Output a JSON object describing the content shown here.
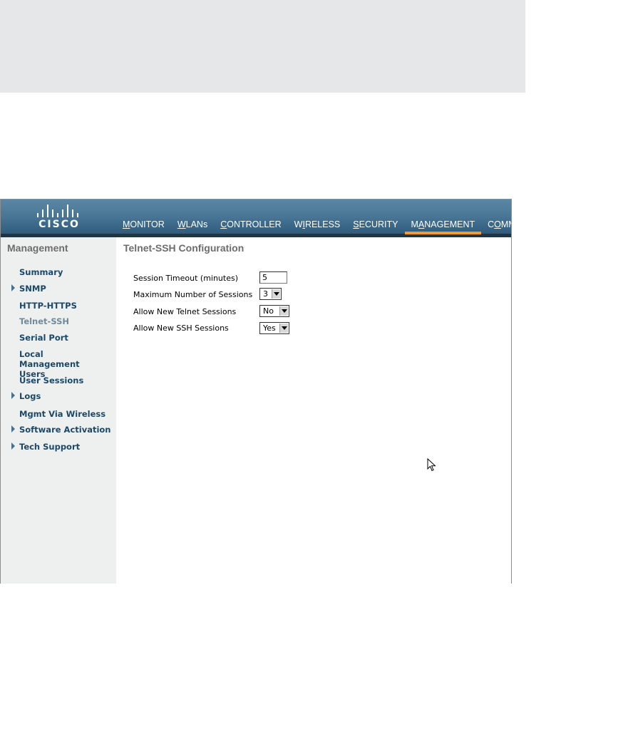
{
  "brand": {
    "logo_text": "CISCO"
  },
  "nav": {
    "items": [
      {
        "key": "M",
        "rest": "ONITOR",
        "pre": ""
      },
      {
        "key": "W",
        "rest": "LANs",
        "pre": ""
      },
      {
        "key": "C",
        "rest": "ONTROLLER",
        "pre": ""
      },
      {
        "key": "I",
        "rest": "RELESS",
        "pre": "W"
      },
      {
        "key": "S",
        "rest": "ECURITY",
        "pre": ""
      },
      {
        "key": "A",
        "rest": "NAGEMENT",
        "pre": "M"
      },
      {
        "key": "O",
        "rest": "MMANDS",
        "pre": "C"
      }
    ],
    "active": "MANAGEMENT"
  },
  "sidebar": {
    "title": "Management",
    "items": [
      {
        "label": "Summary"
      },
      {
        "label": "SNMP"
      },
      {
        "label": "HTTP-HTTPS"
      },
      {
        "label": "Telnet-SSH"
      },
      {
        "label": "Serial Port"
      },
      {
        "label": "Local Management Users"
      },
      {
        "label": "User Sessions"
      },
      {
        "label": "Logs"
      },
      {
        "label": "Mgmt Via Wireless"
      },
      {
        "label": "Software Activation"
      },
      {
        "label": "Tech Support"
      }
    ]
  },
  "main": {
    "title": "Telnet-SSH Configuration",
    "fields": {
      "session_timeout": {
        "label": "Session Timeout (minutes)",
        "value": "5"
      },
      "max_sessions": {
        "label": "Maximum Number of Sessions",
        "value": "3"
      },
      "allow_telnet": {
        "label": "Allow New Telnet Sessions",
        "value": "No"
      },
      "allow_ssh": {
        "label": "Allow New SSH Sessions",
        "value": "Yes"
      }
    }
  },
  "colors": {
    "header": "#4b7898",
    "active_underline": "#f39a31",
    "sidebar_bg": "#eef0f0",
    "sidebar_link": "#1c4868"
  }
}
